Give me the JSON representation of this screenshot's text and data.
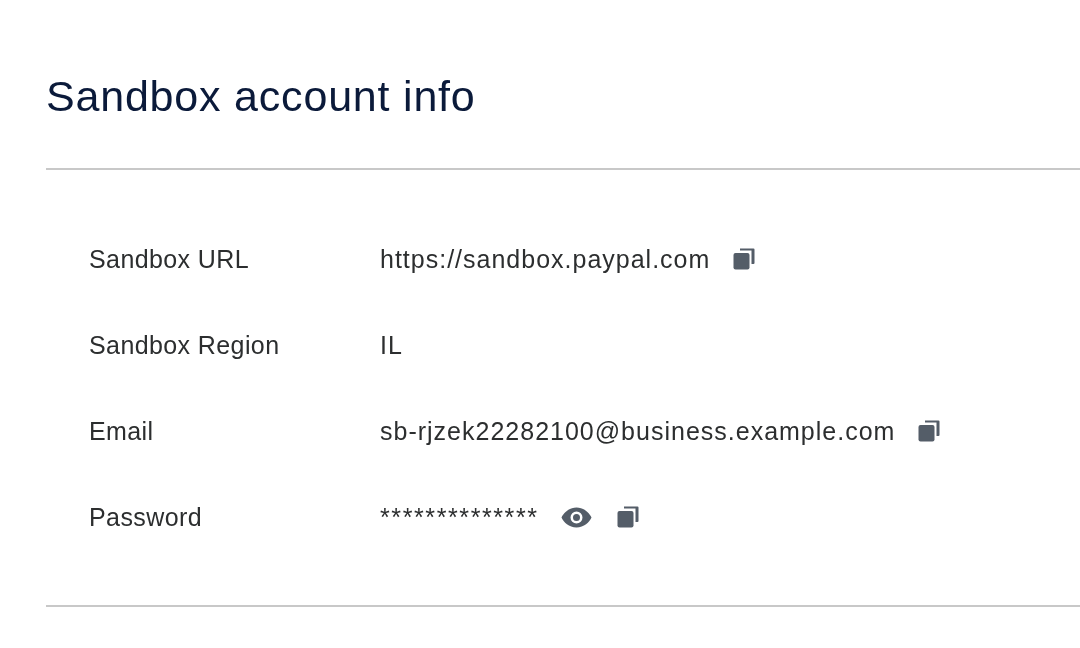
{
  "page": {
    "title": "Sandbox account info"
  },
  "rows": [
    {
      "label": "Sandbox URL",
      "value": "https://sandbox.paypal.com",
      "revealable": false,
      "copyable": true
    },
    {
      "label": "Sandbox Region",
      "value": "IL",
      "revealable": false,
      "copyable": false
    },
    {
      "label": "Email",
      "value": "sb-rjzek22282100@business.example.com",
      "revealable": false,
      "copyable": true
    },
    {
      "label": "Password",
      "value": "**************",
      "revealable": true,
      "copyable": true
    }
  ]
}
